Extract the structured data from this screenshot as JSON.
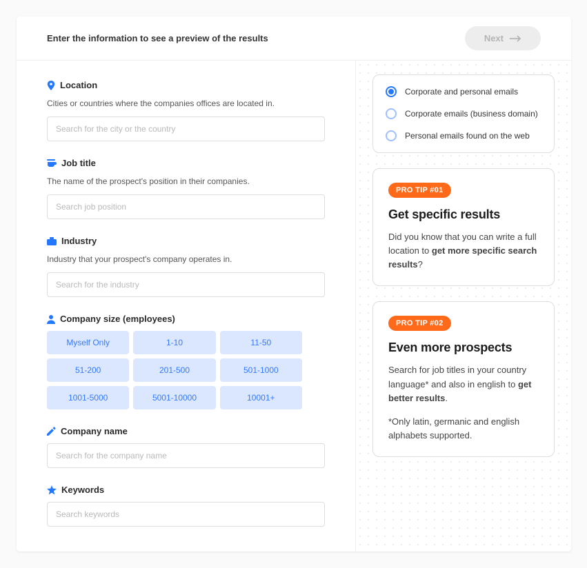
{
  "header": {
    "title": "Enter the information to see a preview of the results",
    "next_label": "Next"
  },
  "sections": {
    "location": {
      "label": "Location",
      "desc": "Cities or countries where the companies offices are located in.",
      "placeholder": "Search for the city or the country"
    },
    "job_title": {
      "label": "Job title",
      "desc": "The name of the prospect's position in their companies.",
      "placeholder": "Search job position"
    },
    "industry": {
      "label": "Industry",
      "desc": "Industry that your prospect's company operates in.",
      "placeholder": "Search for the industry"
    },
    "company_size": {
      "label": "Company size (employees)",
      "options": [
        "Myself Only",
        "1-10",
        "11-50",
        "51-200",
        "201-500",
        "501-1000",
        "1001-5000",
        "5001-10000",
        "10001+"
      ]
    },
    "company_name": {
      "label": "Company name",
      "placeholder": "Search for the company name"
    },
    "keywords": {
      "label": "Keywords",
      "placeholder": "Search keywords"
    }
  },
  "email_filter": {
    "options": [
      {
        "label": "Corporate and personal emails",
        "selected": true
      },
      {
        "label": "Corporate emails (business domain)",
        "selected": false
      },
      {
        "label": "Personal emails found on the web",
        "selected": false
      }
    ]
  },
  "tips": [
    {
      "badge": "PRO TIP #01",
      "title": "Get specific results",
      "body_before": "Did you know that you can write a full location to ",
      "body_bold": "get more specific search results",
      "body_after": "?"
    },
    {
      "badge": "PRO TIP #02",
      "title": "Even more prospects",
      "body_before": "Search for job titles in your country language* and also in english to ",
      "body_bold": "get better results",
      "body_after": ".",
      "note": "*Only latin, germanic and english alphabets supported."
    }
  ]
}
